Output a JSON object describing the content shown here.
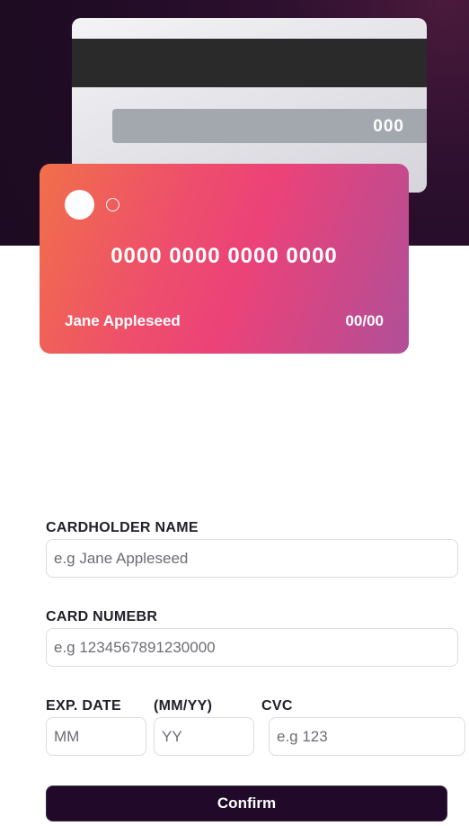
{
  "card_back": {
    "cvc": "000"
  },
  "card_front": {
    "number": "0000 0000 0000 0000",
    "holder": "Jane Appleseed",
    "expiry": "00/00"
  },
  "form": {
    "cardholder_label": "CARDHOLDER NAME",
    "cardholder_placeholder": "e.g Jane Appleseed",
    "number_label": "CARD NUMEBR",
    "number_placeholder": "e.g 1234567891230000",
    "exp_label": "EXP. DATE",
    "exp_format_label": "(MM/YY)",
    "cvc_label": "CVC",
    "mm_placeholder": "MM",
    "yy_placeholder": "YY",
    "cvc_placeholder": "e.g 123",
    "confirm_label": "Confirm"
  }
}
